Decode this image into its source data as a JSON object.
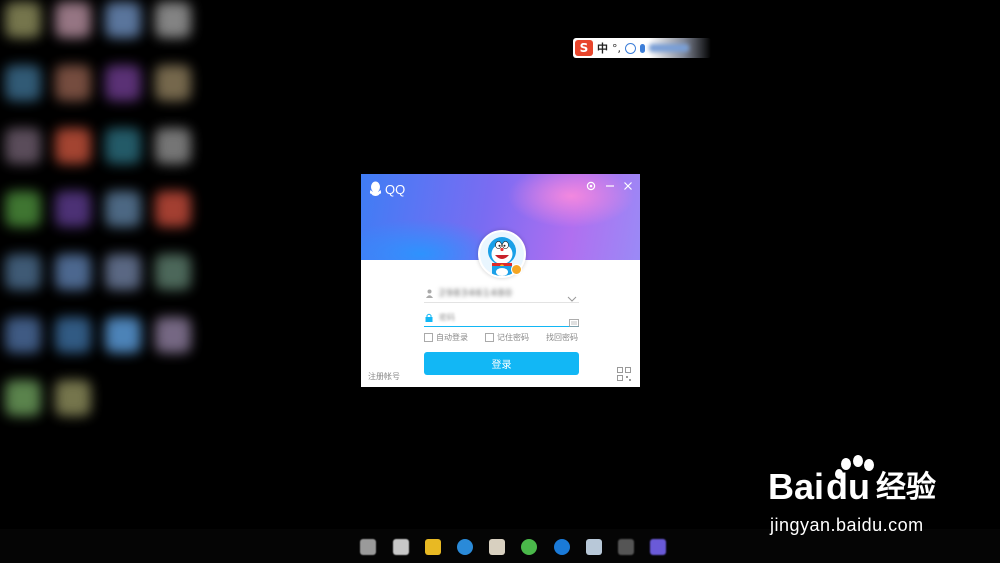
{
  "desktop": {
    "icon_colors": [
      "#8a8a5a",
      "#b08a9a",
      "#6a8ab8",
      "#9a9a9a",
      "#3a6a8a",
      "#8a5a4a",
      "#6a3a8a",
      "#8a7a5a",
      "#6a5a6a",
      "#c0503a",
      "#2a6a7a",
      "#8a8a8a",
      "#4a8a3a",
      "#5a3a8a",
      "#5a7a9a",
      "#c04a3a",
      "#4a6a8a",
      "#5a7aa8",
      "#6a7a9a",
      "#5a7a6a",
      "#4a6a9a",
      "#3a6a9a",
      "#5a9ad8",
      "#8a7a9a",
      "#6a9a5a",
      "#8a8a5a"
    ]
  },
  "ime_bar": {
    "logo": "S",
    "language": "中",
    "punctuation": "°,"
  },
  "qq_window": {
    "app_title": "QQ",
    "account_value": "2983461480",
    "password_placeholder": "密码",
    "auto_login_label": "自动登录",
    "remember_password_label": "记住密码",
    "find_password_label": "找回密码",
    "login_button_label": "登录",
    "register_label": "注册帐号",
    "accent_color": "#12b7f5"
  },
  "watermark": {
    "brand": "Bai",
    "brand_suffix": "du",
    "product": "经验",
    "url": "jingyan.baidu.com"
  }
}
